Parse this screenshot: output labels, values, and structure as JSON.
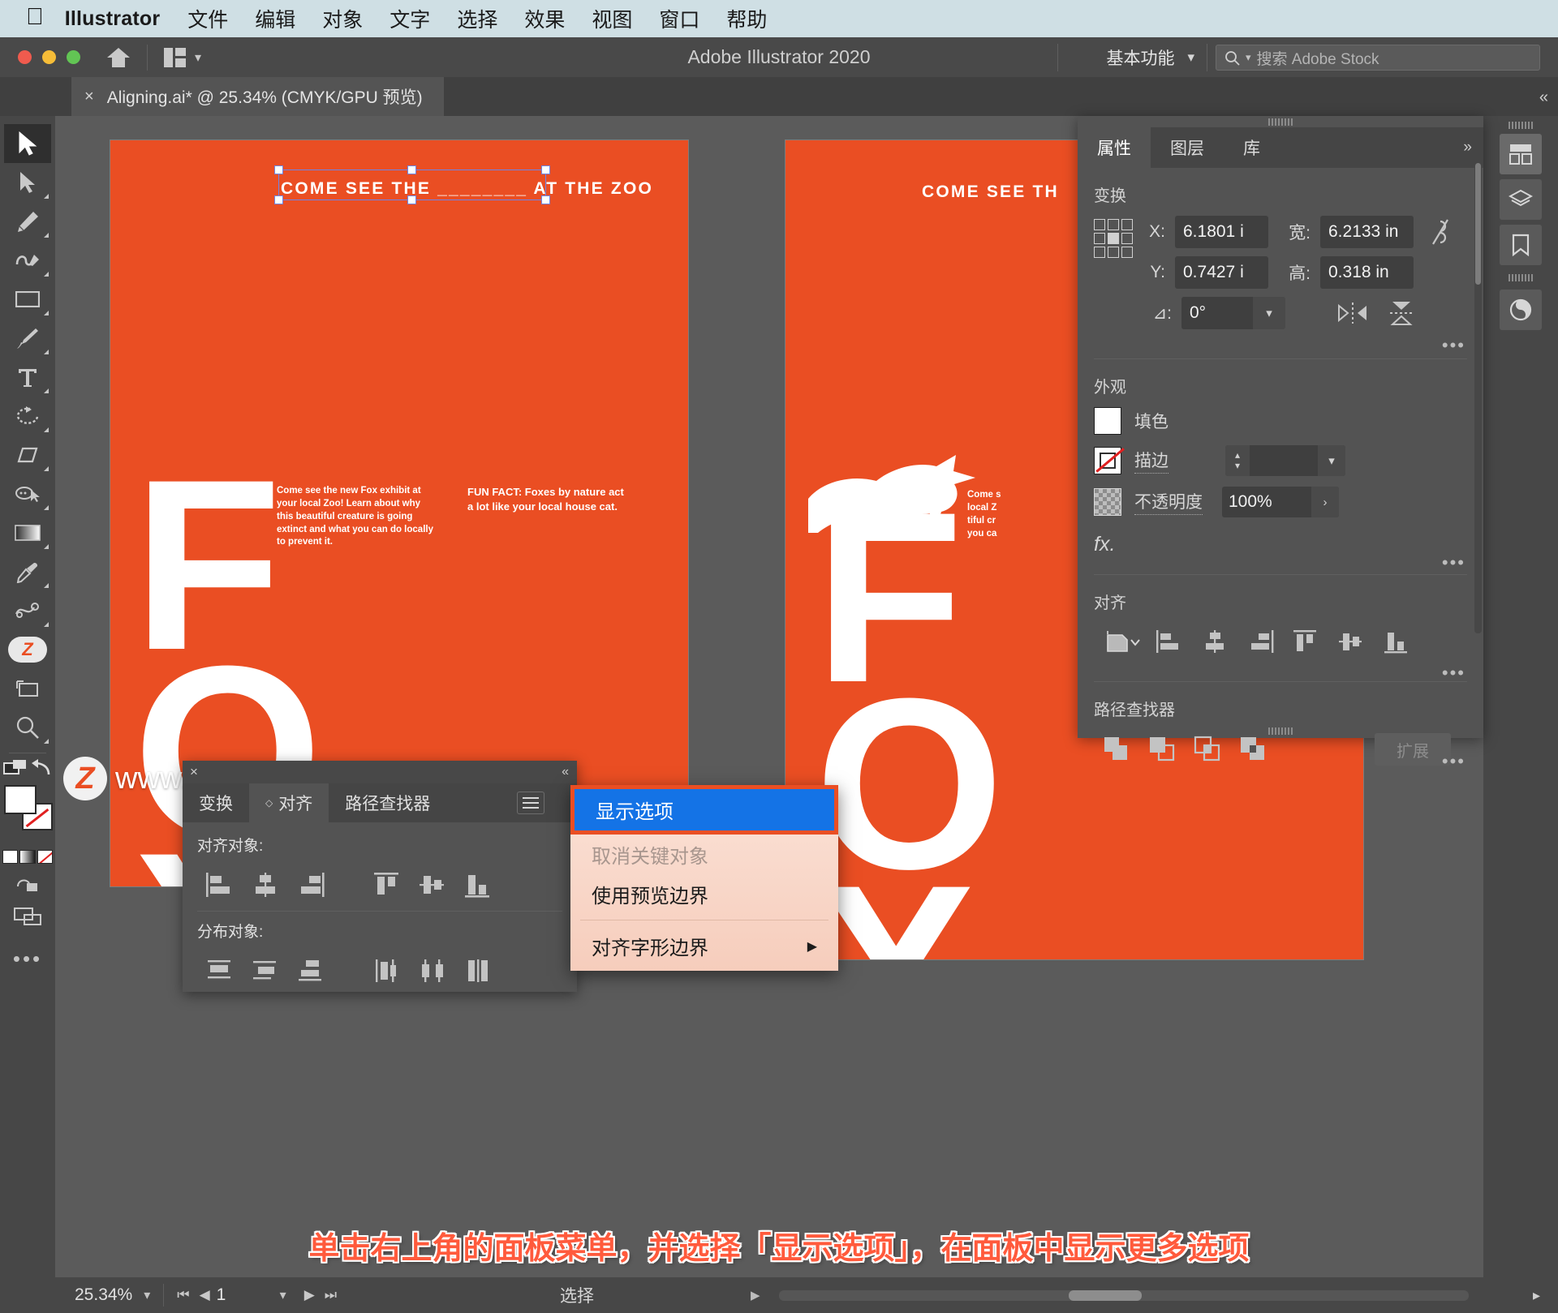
{
  "macos_menu": {
    "app_name": "Illustrator",
    "items": [
      "文件",
      "编辑",
      "对象",
      "文字",
      "选择",
      "效果",
      "视图",
      "窗口",
      "帮助"
    ]
  },
  "titlebar": {
    "title": "Adobe Illustrator 2020",
    "workspace": "基本功能",
    "search_placeholder": "搜索 Adobe Stock",
    "home_icon": "home-icon",
    "arrange_icon": "arrange-documents-icon",
    "search_icon": "search-icon"
  },
  "document_tab": {
    "close_icon": "close-icon",
    "label": "Aligning.ai* @ 25.34% (CMYK/GPU 预览)"
  },
  "toolbar": {
    "tools": [
      {
        "name": "selection-tool",
        "selected": true
      },
      {
        "name": "direct-selection-tool",
        "selected": false
      },
      {
        "name": "pen-tool",
        "selected": false
      },
      {
        "name": "curvature-tool",
        "selected": false
      },
      {
        "name": "rectangle-tool",
        "selected": false
      },
      {
        "name": "paintbrush-tool",
        "selected": false
      },
      {
        "name": "type-tool",
        "selected": false
      },
      {
        "name": "rotate-tool",
        "selected": false
      },
      {
        "name": "eraser-tool",
        "selected": false
      },
      {
        "name": "shape-builder-tool",
        "selected": false
      },
      {
        "name": "gradient-tool",
        "selected": false
      },
      {
        "name": "eyedropper-tool",
        "selected": false
      },
      {
        "name": "width-tool",
        "selected": false
      },
      {
        "name": "free-transform-tool",
        "selected": false
      },
      {
        "name": "artboard-tool",
        "selected": false
      },
      {
        "name": "zoom-tool",
        "selected": false
      }
    ],
    "fill_color": "#ffffff",
    "stroke_color": "none",
    "more_tools_icon": "more-options-icon"
  },
  "artboards": [
    {
      "name": "artboard-left",
      "bg_color": "#ea4e23",
      "headline": "COME SEE THE ________ AT THE ZOO",
      "wordmark": "FOX",
      "body_copy": "Come see the new Fox exhibit at your local Zoo! Learn about why this beautiful creature is going extinct and what you can do locally to prevent it.",
      "fun_fact": "FUN FACT: Foxes by nature act a lot like your local house cat."
    },
    {
      "name": "artboard-right",
      "bg_color": "#ea4e23",
      "headline": "COME SEE TH",
      "wordmark": "FOX",
      "body_copy": "Come s\nlocal Z\ntiful cr\nyou ca"
    }
  ],
  "watermark": {
    "badge": "Z",
    "text": "www.MacZ.com"
  },
  "align_panel": {
    "close_icon": "close-icon",
    "collapse_icon": "collapse-icon",
    "menu_icon": "panel-menu-icon",
    "tabs": [
      {
        "label": "变换",
        "active": false
      },
      {
        "label": "对齐",
        "active": true
      },
      {
        "label": "路径查找器",
        "active": false
      }
    ],
    "align_objects_label": "对齐对象:",
    "distribute_objects_label": "分布对象:",
    "align_icons": [
      "align-left-icon",
      "align-horizontal-center-icon",
      "align-right-icon",
      "align-top-icon",
      "align-vertical-center-icon",
      "align-bottom-icon"
    ],
    "distribute_icons": [
      "distribute-top-icon",
      "distribute-vertical-center-icon",
      "distribute-bottom-icon",
      "distribute-left-icon",
      "distribute-horizontal-center-icon",
      "distribute-right-icon"
    ]
  },
  "context_menu": {
    "items": [
      {
        "label": "显示选项",
        "state": "highlighted"
      },
      {
        "label": "取消关键对象",
        "state": "disabled"
      },
      {
        "label": "使用预览边界",
        "state": "normal"
      },
      {
        "label": "对齐字形边界",
        "state": "submenu",
        "arrow": "▶"
      }
    ]
  },
  "properties_panel": {
    "tabs": [
      {
        "label": "属性",
        "active": true
      },
      {
        "label": "图层",
        "active": false
      },
      {
        "label": "库",
        "active": false
      }
    ],
    "collapse_icon": "double-chevron-right-icon",
    "transform": {
      "title": "变换",
      "anchor_icon": "reference-point-icon",
      "x_label": "X:",
      "x_value": "6.1801 i",
      "y_label": "Y:",
      "y_value": "0.7427 i",
      "w_label": "宽:",
      "w_value": "6.2133 in",
      "h_label": "高:",
      "h_value": "0.318 in",
      "angle_label": "⊿:",
      "angle_value": "0°",
      "link_icon": "constrain-proportions-unlinked-icon",
      "flip_h_icon": "flip-horizontal-icon",
      "flip_v_icon": "flip-vertical-icon",
      "more_icon": "more-options-icon"
    },
    "appearance": {
      "title": "外观",
      "fill_label": "填色",
      "fill_color": "#ffffff",
      "stroke_label": "描边",
      "stroke_color": "none",
      "stroke_weight": "",
      "opacity_label": "不透明度",
      "opacity_value": "100%",
      "fx_label": "fx.",
      "more_icon": "more-options-icon"
    },
    "align": {
      "title": "对齐",
      "align_to_icon": "align-to-selection-icon",
      "icons": [
        "align-left-icon",
        "align-horizontal-center-icon",
        "align-right-icon",
        "align-top-icon",
        "align-vertical-center-icon",
        "align-bottom-icon"
      ],
      "more_icon": "more-options-icon"
    },
    "pathfinder": {
      "title": "路径查找器",
      "expand_label": "扩展",
      "icons": [
        "unite-icon",
        "minus-front-icon",
        "intersect-icon",
        "exclude-icon"
      ],
      "more_icon": "more-options-icon"
    }
  },
  "right_rail": {
    "buttons": [
      "properties-panel-icon",
      "layers-panel-icon",
      "libraries-panel-icon",
      "color-panel-icon"
    ],
    "expand_icon": "double-chevron-left-icon"
  },
  "caption": {
    "text": "单击右上角的面板菜单，并选择「显示选项」，在面板中显示更多选项"
  },
  "statusbar": {
    "zoom": "25.34%",
    "zoom_chevron": "chevron-down-icon",
    "first_page_icon": "first-artboard-icon",
    "prev_page_icon": "previous-artboard-icon",
    "page_number": "1",
    "page_chevron": "chevron-down-icon",
    "next_page_icon": "next-artboard-icon",
    "last_page_icon": "last-artboard-icon",
    "status_text": "选择",
    "status_arrow": "chevron-right-icon",
    "scroll_left_icon": "scroll-left-icon",
    "panel_chevron": "chevron-right-icon"
  }
}
